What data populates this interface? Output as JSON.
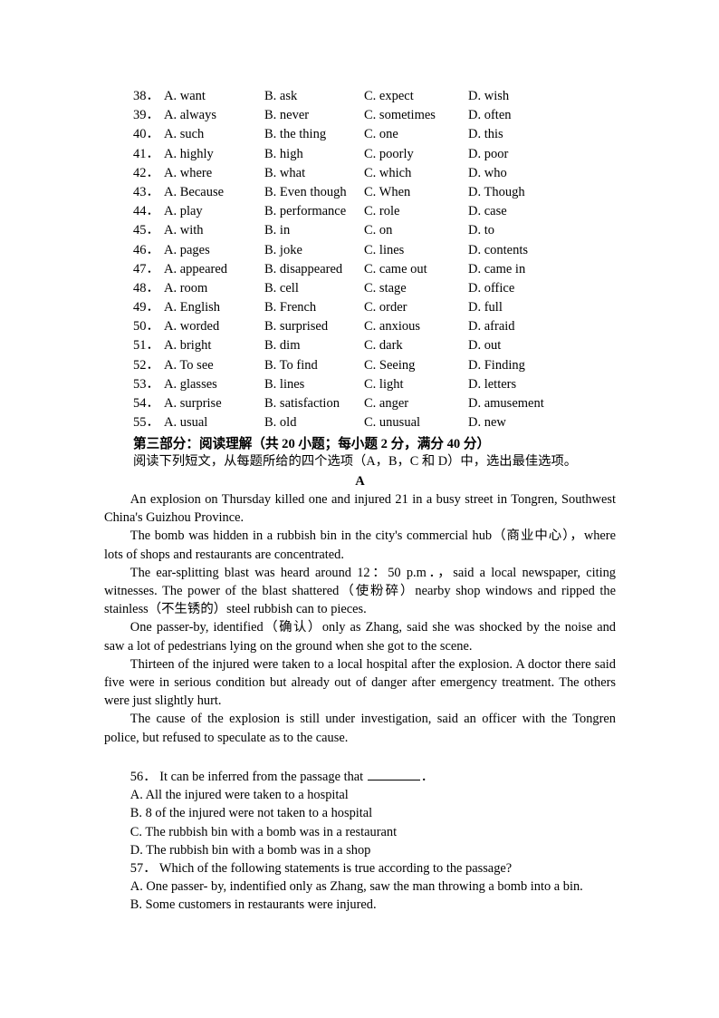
{
  "cloze_options": {
    "rows": [
      {
        "num": "38．",
        "a": "A. want",
        "b": "B. ask",
        "c": "C. expect",
        "d": "D. wish"
      },
      {
        "num": "39．",
        "a": "A. always",
        "b": "B. never",
        "c": "C. sometimes",
        "d": "D. often"
      },
      {
        "num": "40．",
        "a": "A. such",
        "b": "B. the thing",
        "c": "C. one",
        "d": "D. this"
      },
      {
        "num": "41．",
        "a": "A. highly",
        "b": "B. high",
        "c": "C. poorly",
        "d": "D. poor"
      },
      {
        "num": "42．",
        "a": "A. where",
        "b": "B. what",
        "c": "C. which",
        "d": "D. who"
      },
      {
        "num": "43．",
        "a": "A. Because",
        "b": "B. Even though",
        "c": "C. When",
        "d": "D. Though"
      },
      {
        "num": "44．",
        "a": "A. play",
        "b": "B. performance",
        "c": "C. role",
        "d": "D. case"
      },
      {
        "num": "45．",
        "a": "A. with",
        "b": "B. in",
        "c": "C. on",
        "d": "D. to"
      },
      {
        "num": "46．",
        "a": "A. pages",
        "b": "B. joke",
        "c": "C. lines",
        "d": "D. contents"
      },
      {
        "num": "47．",
        "a": "A. appeared",
        "b": "B. disappeared",
        "c": "C. came out",
        "d": "D. came in"
      },
      {
        "num": "48．",
        "a": "A. room",
        "b": "B. cell",
        "c": "C. stage",
        "d": "D. office"
      },
      {
        "num": "49．",
        "a": "A. English",
        "b": "B. French",
        "c": "C. order",
        "d": "D. full"
      },
      {
        "num": "50．",
        "a": "A. worded",
        "b": "B. surprised",
        "c": "C. anxious",
        "d": "D. afraid"
      },
      {
        "num": "51．",
        "a": "A. bright",
        "b": "B. dim",
        "c": "C. dark",
        "d": "D. out"
      },
      {
        "num": "52．",
        "a": "A. To see",
        "b": "B. To find",
        "c": "C. Seeing",
        "d": "D. Finding"
      },
      {
        "num": "53．",
        "a": "A. glasses",
        "b": "B. lines",
        "c": "C. light",
        "d": "D. letters"
      },
      {
        "num": "54．",
        "a": "A. surprise",
        "b": "B. satisfaction",
        "c": "C. anger",
        "d": "D. amusement"
      },
      {
        "num": "55．",
        "a": "A. usual",
        "b": "B. old",
        "c": "C. unusual",
        "d": "D. new"
      }
    ]
  },
  "section": {
    "heading": "第三部分：阅读理解（共 20 小题；每小题 2 分，满分 40 分）",
    "instruction": "阅读下列短文，从每题所给的四个选项（A，B，C 和 D）中，选出最佳选项。"
  },
  "passage": {
    "title": "A",
    "paragraphs": [
      "An explosion on Thursday killed one and injured 21 in a busy street in Tongren, Southwest China's Guizhou Province.",
      "The bomb was hidden in a rubbish bin in the city's commercial hub（商业中心），where lots of shops and restaurants are concentrated.",
      "The ear-splitting blast was heard around 12：50 p.m．，said a local newspaper, citing witnesses. The power of the blast shattered（使粉碎）nearby shop windows and ripped the stainless（不生锈的）steel rubbish can to pieces.",
      "One passer-by, identified（确认）only as Zhang, said she was shocked by the noise and saw a lot of pedestrians lying on the ground when she got to the scene.",
      "Thirteen of the injured were taken to a local hospital after the explosion. A doctor there said five were in serious condition but already out of danger after emergency treatment. The others were just slightly hurt.",
      "The cause of the explosion is still under investigation, said an officer with the Tongren police, but refused to speculate as to the cause."
    ]
  },
  "questions": [
    {
      "num": "56．",
      "stem_before": "It can be inferred from the passage that ",
      "stem_after": "．",
      "has_blank": true,
      "options": [
        "A. All the injured were taken to a hospital",
        "B. 8 of the injured were not taken to a hospital",
        "C. The rubbish bin with a bomb was in a restaurant",
        "D. The rubbish bin with a bomb was in a shop"
      ]
    },
    {
      "num": "57．",
      "stem_before": "Which of the following statements is true according to the passage?",
      "stem_after": "",
      "has_blank": false,
      "options": [
        "A. One passer- by, indentified only as Zhang, saw the man throwing a bomb into a bin.",
        "B. Some customers in restaurants were injured."
      ]
    }
  ]
}
